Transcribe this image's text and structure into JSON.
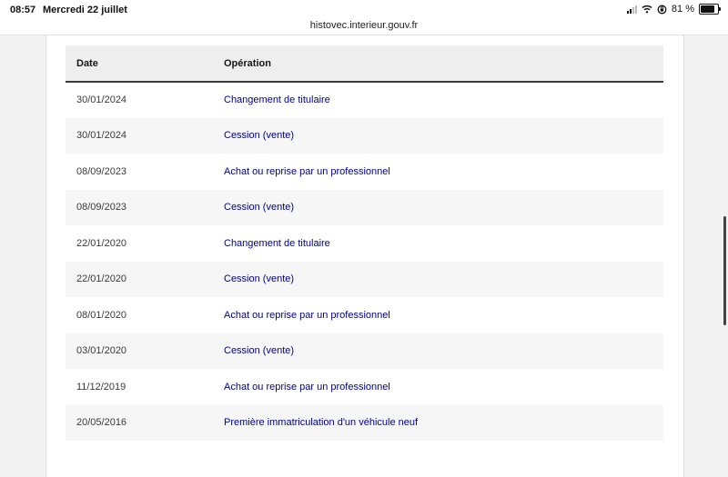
{
  "status_bar": {
    "time": "08:57",
    "date": "Mercredi 22 juillet",
    "battery": "81 %",
    "battery_level": 0.81
  },
  "browser": {
    "url": "histovec.interieur.gouv.fr"
  },
  "history_table": {
    "headers": {
      "date": "Date",
      "operation": "Opération"
    },
    "rows": [
      {
        "date": "30/01/2024",
        "operation": "Changement de titulaire"
      },
      {
        "date": "30/01/2024",
        "operation": "Cession (vente)"
      },
      {
        "date": "08/09/2023",
        "operation": "Achat ou reprise par un professionnel"
      },
      {
        "date": "08/09/2023",
        "operation": "Cession (vente)"
      },
      {
        "date": "22/01/2020",
        "operation": "Changement de titulaire"
      },
      {
        "date": "22/01/2020",
        "operation": "Cession (vente)"
      },
      {
        "date": "08/01/2020",
        "operation": "Achat ou reprise par un professionnel"
      },
      {
        "date": "03/01/2020",
        "operation": "Cession (vente)"
      },
      {
        "date": "11/12/2019",
        "operation": "Achat ou reprise par un professionnel"
      },
      {
        "date": "20/05/2016",
        "operation": "Première immatriculation d'un véhicule neuf"
      }
    ]
  },
  "colors": {
    "operation_text": "#000091",
    "header_bg": "#eeeeee",
    "striped_row_bg": "#f6f6f6"
  },
  "icons": [
    "signal-icon",
    "wifi-icon",
    "lock-rotation-icon",
    "battery-icon"
  ]
}
